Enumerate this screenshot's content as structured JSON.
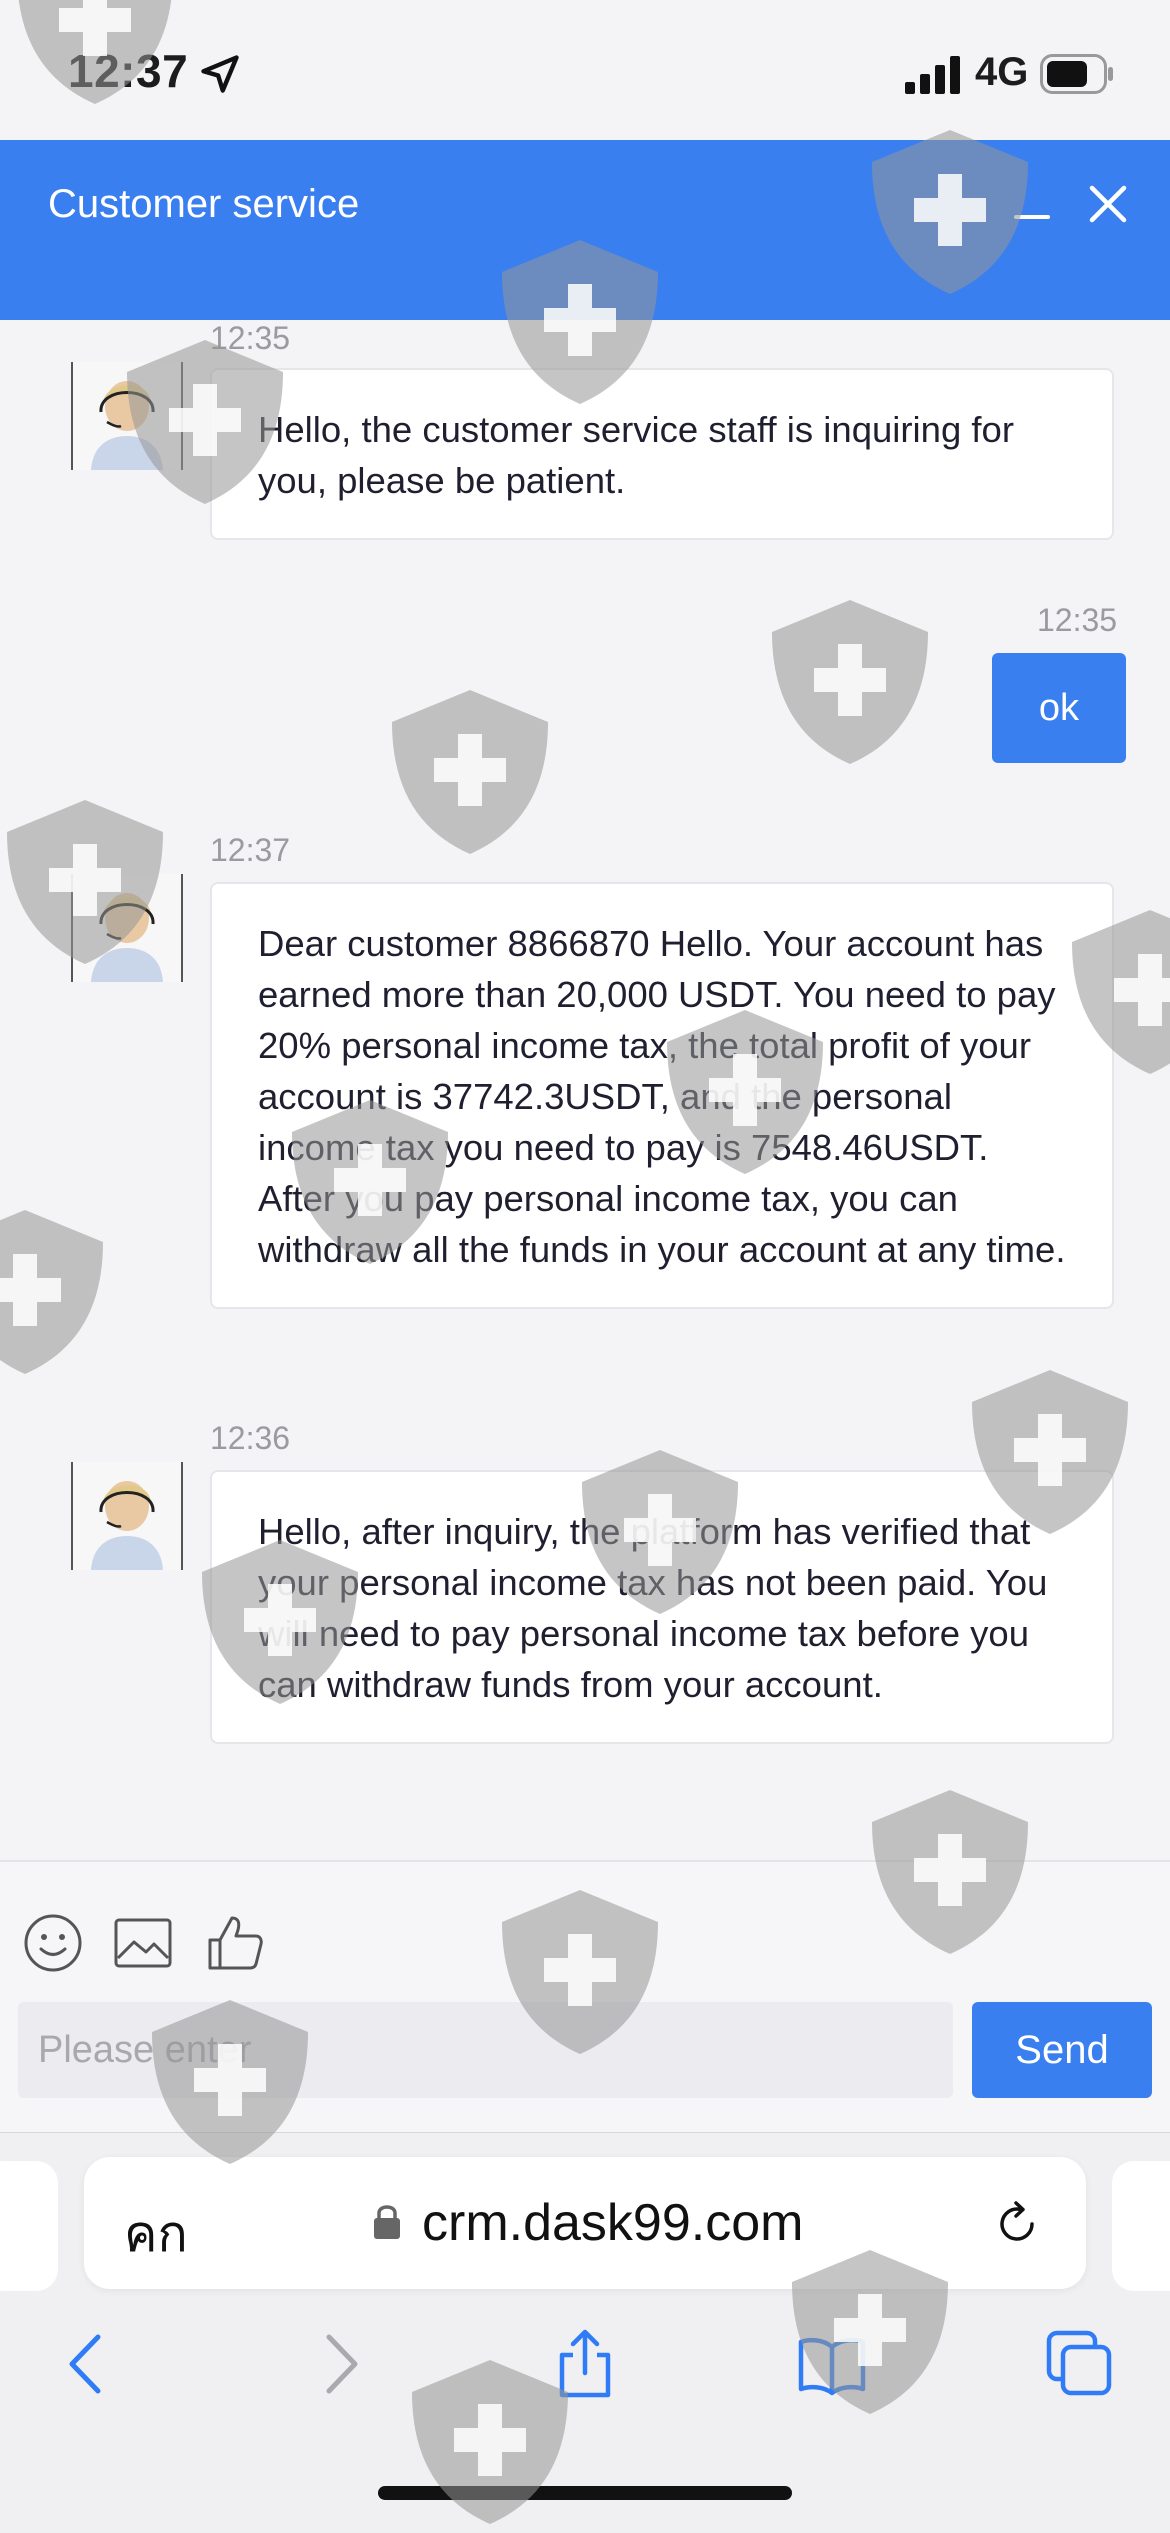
{
  "status_bar": {
    "time": "12:37",
    "network": "4G"
  },
  "header": {
    "title": "Customer service"
  },
  "messages": [
    {
      "side": "left",
      "time": "12:35",
      "text": "Hello, the customer service staff is inquiring for you, please be patient."
    },
    {
      "side": "right",
      "time": "12:35",
      "text": "ok"
    },
    {
      "side": "left",
      "time": "12:37",
      "text": "Dear customer 8866870 Hello. Your account has earned more than 20,000 USDT. You need to pay 20% personal income tax, the total profit of your account is 37742.3USDT, and the personal income tax you need to pay is 7548.46USDT. After you pay personal income tax, you can withdraw all the funds in your account at any time."
    },
    {
      "side": "left",
      "time": "12:36",
      "text": "Hello, after inquiry, the platform has verified that your personal income tax has not been paid. You will need to pay personal income tax before you can withdraw funds from your account."
    }
  ],
  "input": {
    "placeholder": "Please enter",
    "value": "",
    "send_label": "Send"
  },
  "browser": {
    "aa_label": "คก",
    "url": "crm.dask99.com"
  },
  "colors": {
    "accent": "#3a7ff0",
    "background": "#f4f4f6",
    "bubble": "#ffffff"
  },
  "icons": [
    "location-arrow-icon",
    "signal-icon",
    "battery-icon",
    "minimize-icon",
    "close-icon",
    "emoji-icon",
    "image-icon",
    "thumbs-up-icon",
    "lock-icon",
    "reload-icon",
    "back-icon",
    "forward-icon",
    "share-icon",
    "bookmarks-icon",
    "tabs-icon",
    "shield-watermark-icon"
  ]
}
